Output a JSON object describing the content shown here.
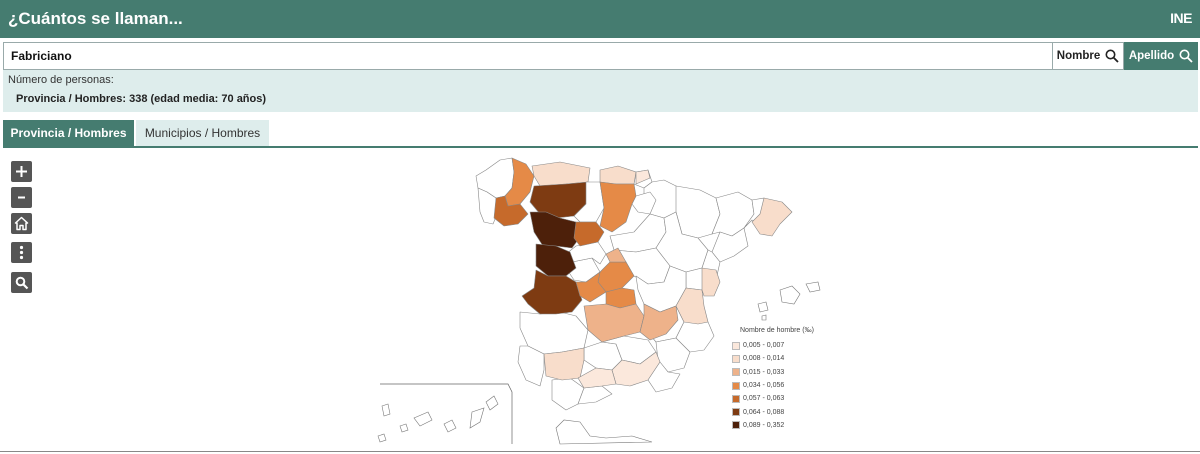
{
  "header": {
    "title": "¿Cuántos se llaman...",
    "logo_text": "INE"
  },
  "search": {
    "value": "Fabriciano",
    "nombre_label": "Nombre",
    "apellido_label": "Apellido"
  },
  "info": {
    "label": "Número de personas:",
    "value": "Provincia / Hombres: 338 (edad media: 70 años)"
  },
  "tabs": [
    {
      "label": "Provincia / Hombres",
      "active": true
    },
    {
      "label": "Municipios / Hombres",
      "active": false
    }
  ],
  "tools": [
    "zoom-in-icon",
    "zoom-out-icon",
    "home-icon",
    "more-options-icon",
    "search-icon"
  ],
  "legend": {
    "title": "Nombre de hombre (‰)",
    "items": [
      {
        "label": "0,005 - 0,007",
        "color": "#fbe8dc"
      },
      {
        "label": "0,008 - 0,014",
        "color": "#f8ddcb"
      },
      {
        "label": "0,015 - 0,033",
        "color": "#eeb28a"
      },
      {
        "label": "0,034 - 0,056",
        "color": "#e58a47"
      },
      {
        "label": "0,057 - 0,063",
        "color": "#c66a2b"
      },
      {
        "label": "0,064 - 0,088",
        "color": "#7e3b12"
      },
      {
        "label": "0,089 - 0,352",
        "color": "#4d200a"
      }
    ]
  },
  "colors": {
    "brand": "#457c70",
    "panel": "#deedec"
  }
}
